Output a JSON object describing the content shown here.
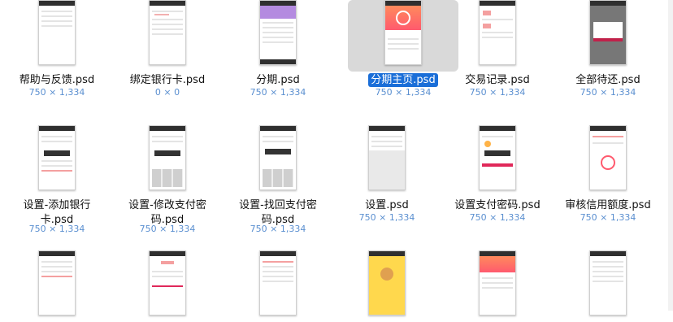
{
  "files": [
    {
      "name": "帮助与反馈.psd",
      "dims": "750 × 1,334"
    },
    {
      "name": "绑定银行卡.psd",
      "dims": "0 × 0"
    },
    {
      "name": "分期.psd",
      "dims": "750 × 1,334"
    },
    {
      "name": "分期主页.psd",
      "dims": "750 × 1,334",
      "selected": true
    },
    {
      "name": "交易记录.psd",
      "dims": "750 × 1,334"
    },
    {
      "name": "全部待还.psd",
      "dims": "750 × 1,334"
    },
    {
      "name_line1": "设置-添加银行",
      "name_line2": "卡.psd",
      "dims": "750 × 1,334"
    },
    {
      "name_line1": "设置-修改支付密",
      "name_line2": "码.psd",
      "dims": "750 × 1,334"
    },
    {
      "name_line1": "设置-找回支付密",
      "name_line2": "码.psd",
      "dims": "750 × 1,334"
    },
    {
      "name": "设置.psd",
      "dims": "750 × 1,334"
    },
    {
      "name": "设置支付密码.psd",
      "dims": "750 × 1,334"
    },
    {
      "name": "审核信用额度.psd",
      "dims": "750 × 1,334"
    }
  ],
  "colors": {
    "selection": "#1a6ed8",
    "dims_text": "#5a8fd0"
  }
}
